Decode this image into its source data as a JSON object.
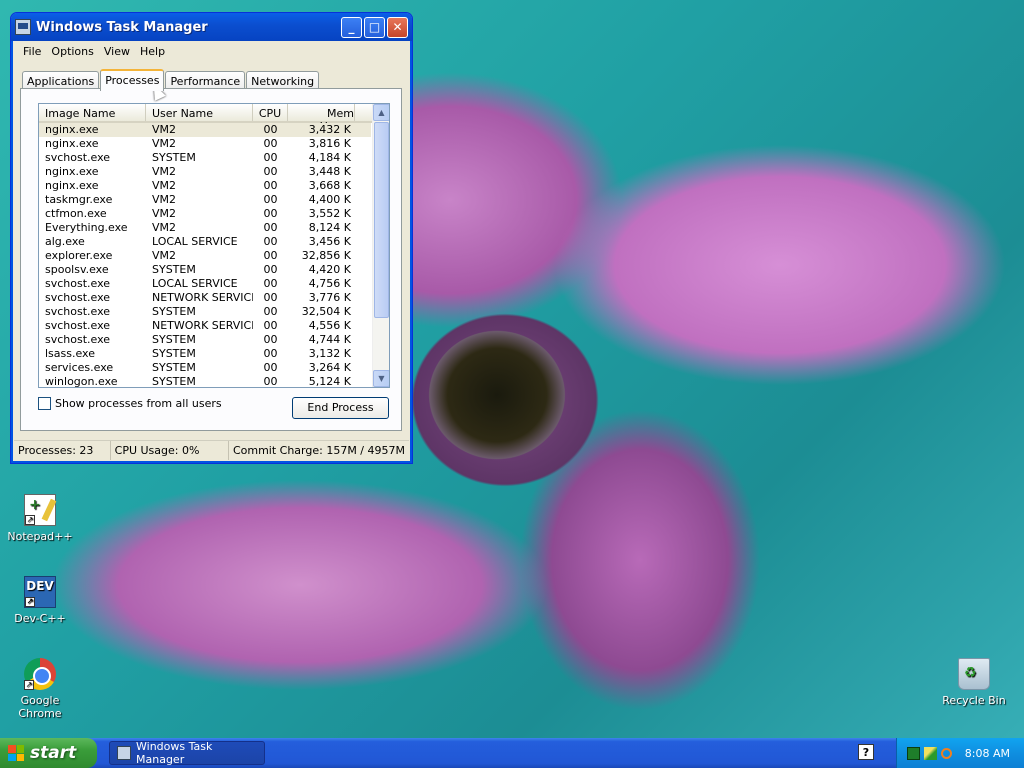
{
  "window": {
    "title": "Windows Task Manager",
    "controls": {
      "minimize": "_",
      "maximize": "□",
      "close": "✕"
    },
    "menu": [
      "File",
      "Options",
      "View",
      "Help"
    ],
    "tabs": [
      "Applications",
      "Processes",
      "Performance",
      "Networking"
    ],
    "active_tab": "Processes",
    "columns": [
      "Image Name",
      "User Name",
      "CPU",
      "Mem Usage"
    ],
    "rows": [
      {
        "name": "nginx.exe",
        "user": "VM2",
        "cpu": "00",
        "mem": "3,432 K"
      },
      {
        "name": "nginx.exe",
        "user": "VM2",
        "cpu": "00",
        "mem": "3,816 K"
      },
      {
        "name": "svchost.exe",
        "user": "SYSTEM",
        "cpu": "00",
        "mem": "4,184 K"
      },
      {
        "name": "nginx.exe",
        "user": "VM2",
        "cpu": "00",
        "mem": "3,448 K"
      },
      {
        "name": "nginx.exe",
        "user": "VM2",
        "cpu": "00",
        "mem": "3,668 K"
      },
      {
        "name": "taskmgr.exe",
        "user": "VM2",
        "cpu": "00",
        "mem": "4,400 K"
      },
      {
        "name": "ctfmon.exe",
        "user": "VM2",
        "cpu": "00",
        "mem": "3,552 K"
      },
      {
        "name": "Everything.exe",
        "user": "VM2",
        "cpu": "00",
        "mem": "8,124 K"
      },
      {
        "name": "alg.exe",
        "user": "LOCAL SERVICE",
        "cpu": "00",
        "mem": "3,456 K"
      },
      {
        "name": "explorer.exe",
        "user": "VM2",
        "cpu": "00",
        "mem": "32,856 K"
      },
      {
        "name": "spoolsv.exe",
        "user": "SYSTEM",
        "cpu": "00",
        "mem": "4,420 K"
      },
      {
        "name": "svchost.exe",
        "user": "LOCAL SERVICE",
        "cpu": "00",
        "mem": "4,756 K"
      },
      {
        "name": "svchost.exe",
        "user": "NETWORK SERVICE",
        "cpu": "00",
        "mem": "3,776 K"
      },
      {
        "name": "svchost.exe",
        "user": "SYSTEM",
        "cpu": "00",
        "mem": "32,504 K"
      },
      {
        "name": "svchost.exe",
        "user": "NETWORK SERVICE",
        "cpu": "00",
        "mem": "4,556 K"
      },
      {
        "name": "svchost.exe",
        "user": "SYSTEM",
        "cpu": "00",
        "mem": "4,744 K"
      },
      {
        "name": "lsass.exe",
        "user": "SYSTEM",
        "cpu": "00",
        "mem": "3,132 K"
      },
      {
        "name": "services.exe",
        "user": "SYSTEM",
        "cpu": "00",
        "mem": "3,264 K"
      },
      {
        "name": "winlogon.exe",
        "user": "SYSTEM",
        "cpu": "00",
        "mem": "5,124 K"
      }
    ],
    "show_all_label": "Show processes from all users",
    "end_process_label": "End Process",
    "status": {
      "processes": "Processes: 23",
      "cpu": "CPU Usage: 0%",
      "commit": "Commit Charge: 157M / 4957M"
    }
  },
  "desktop": {
    "icons": [
      {
        "label": "Notepad++",
        "icon": "notepadpp-icon"
      },
      {
        "label": "Dev-C++",
        "icon": "devcpp-icon",
        "badge": "DEV"
      },
      {
        "label": "Google Chrome",
        "icon": "chrome-icon"
      },
      {
        "label": "Recycle Bin",
        "icon": "recycle-bin-icon"
      }
    ]
  },
  "taskbar": {
    "start_label": "start",
    "task_button": "Windows Task Manager",
    "help_icon": "?",
    "clock": "8:08 AM"
  }
}
